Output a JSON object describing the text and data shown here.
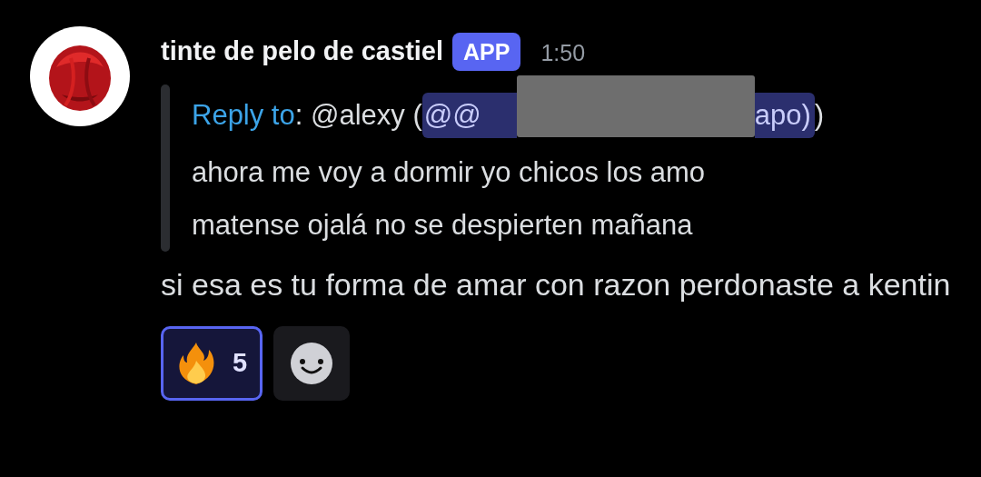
{
  "message": {
    "author": "tinte de pelo de castiel",
    "badge": "APP",
    "time": "1:50",
    "quote": {
      "reply_label": "Reply to",
      "after_label": ": @alexy (",
      "mention_start": "@@",
      "mention_end": "apo)",
      "closing": ")",
      "redacted": true,
      "lines": [
        "ahora me voy a dormir yo chicos los amo",
        "matense ojalá no se despierten mañana"
      ]
    },
    "body": "si esa es tu forma de amar con razon perdonaste a kentin",
    "reactions": [
      {
        "count": "5",
        "selected": true
      }
    ]
  }
}
